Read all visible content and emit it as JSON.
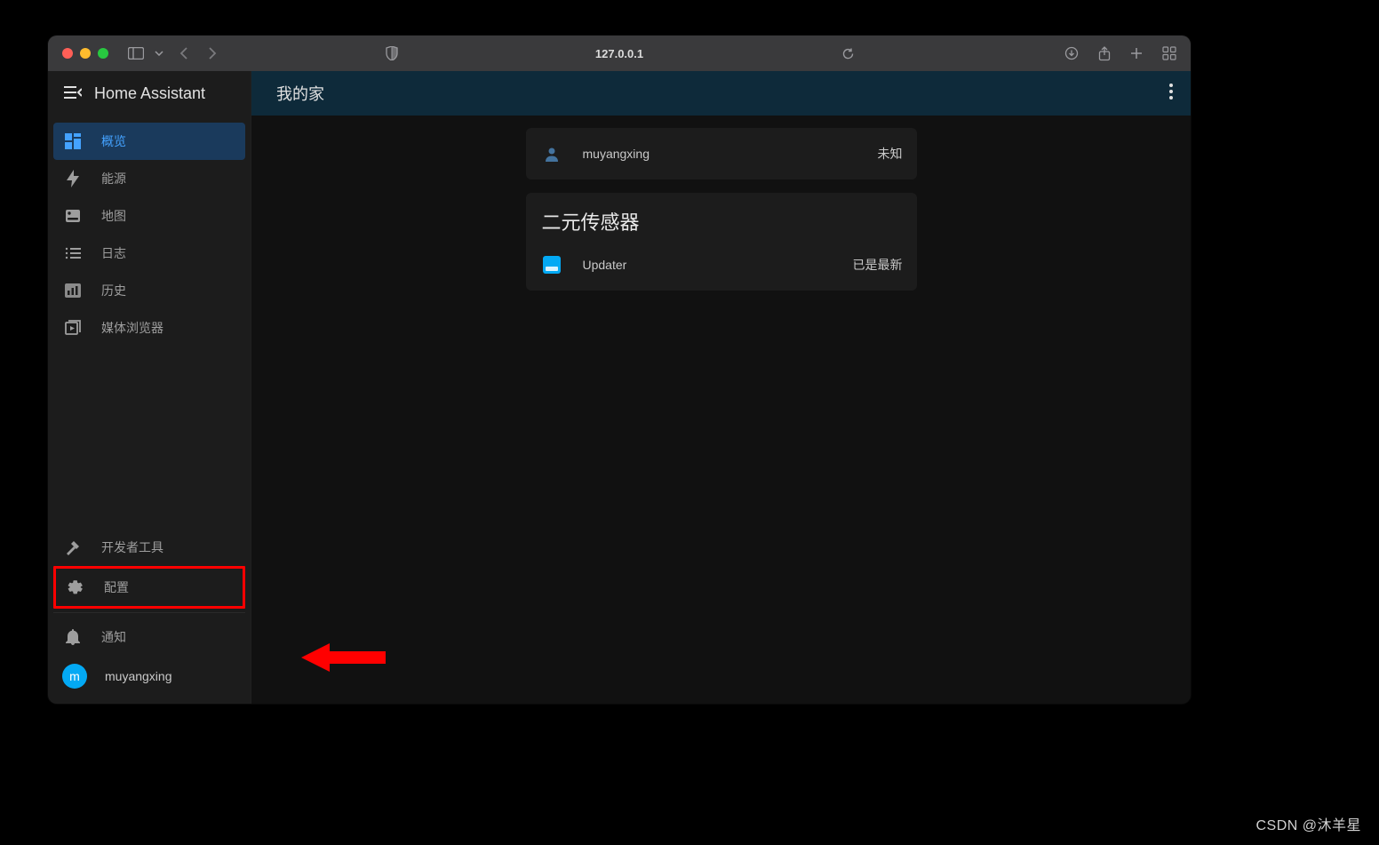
{
  "browser": {
    "address": "127.0.0.1"
  },
  "sidebar": {
    "title": "Home Assistant",
    "items": [
      {
        "label": "概览",
        "icon": "dashboard-icon",
        "active": true
      },
      {
        "label": "能源",
        "icon": "bolt-icon"
      },
      {
        "label": "地图",
        "icon": "map-icon"
      },
      {
        "label": "日志",
        "icon": "list-icon"
      },
      {
        "label": "历史",
        "icon": "chart-icon"
      },
      {
        "label": "媒体浏览器",
        "icon": "play-box-icon"
      }
    ],
    "bottom": [
      {
        "label": "开发者工具",
        "icon": "hammer-icon"
      },
      {
        "label": "配置",
        "icon": "gear-icon",
        "highlighted": true
      }
    ],
    "notification_label": "通知",
    "user": {
      "initial": "m",
      "name": "muyangxing"
    }
  },
  "main": {
    "title": "我的家",
    "person_card": {
      "name": "muyangxing",
      "status": "未知"
    },
    "sensor_card": {
      "title": "二元传感器",
      "row": {
        "label": "Updater",
        "status": "已是最新"
      }
    }
  },
  "watermark": "CSDN @沐羊星"
}
